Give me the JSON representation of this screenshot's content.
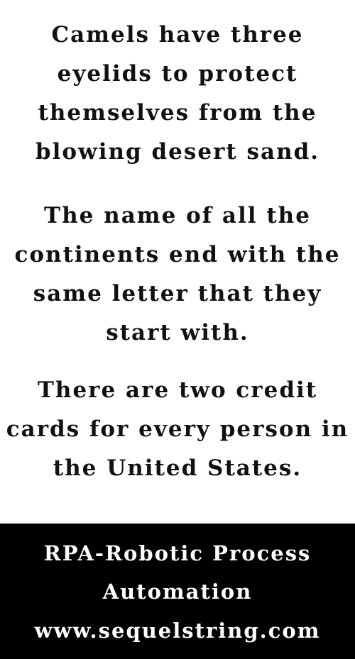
{
  "facts": [
    {
      "lines": [
        "Camels have three",
        "eyelids to protect",
        "themselves from the",
        "blowing desert sand."
      ]
    },
    {
      "lines": [
        "The name of all the",
        "continents end with the",
        "same letter that they",
        "start with."
      ]
    },
    {
      "lines": [
        "There are two credit",
        "cards for every person in",
        "the United States."
      ]
    }
  ],
  "footer": {
    "title_line1": "RPA-Robotic Process",
    "title_line2": "Automation",
    "url": "www.sequelstring.com"
  },
  "colors": {
    "background": "#ffffff",
    "text": "#111111",
    "footer_background": "#000000",
    "footer_text": "#ffffff"
  }
}
